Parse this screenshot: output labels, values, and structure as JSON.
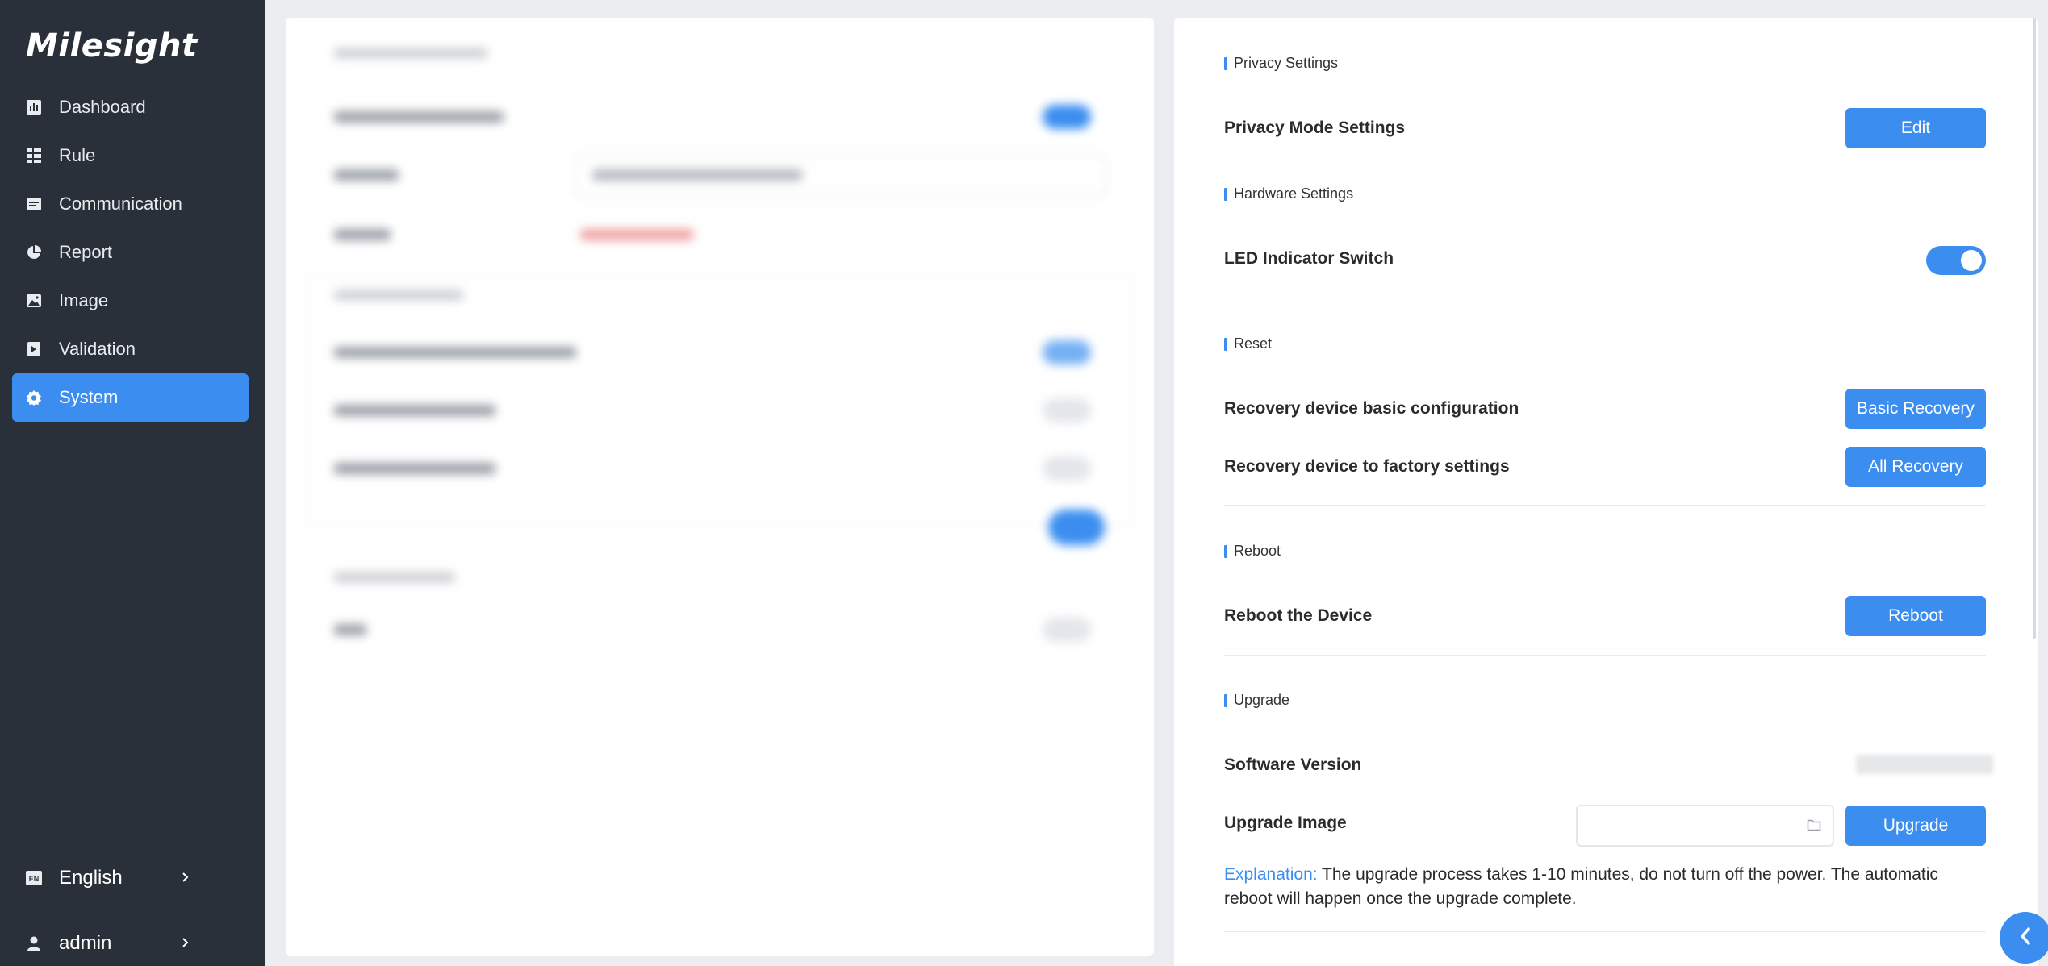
{
  "brand": {
    "logo_text": "Milesight"
  },
  "sidebar": {
    "items": [
      {
        "label": "Dashboard",
        "icon": "dashboard-icon"
      },
      {
        "label": "Rule",
        "icon": "rule-icon"
      },
      {
        "label": "Communication",
        "icon": "communication-icon"
      },
      {
        "label": "Report",
        "icon": "report-icon"
      },
      {
        "label": "Image",
        "icon": "image-icon"
      },
      {
        "label": "Validation",
        "icon": "validation-icon"
      },
      {
        "label": "System",
        "icon": "gear-icon",
        "active": true
      }
    ],
    "language": {
      "label": "English",
      "badge": "EN"
    },
    "user": {
      "label": "admin"
    }
  },
  "settings": {
    "privacy": {
      "section_title": "Privacy Settings",
      "row_label": "Privacy Mode Settings",
      "button_label": "Edit"
    },
    "hardware": {
      "section_title": "Hardware Settings",
      "row_label": "LED Indicator Switch",
      "led_enabled": true
    },
    "reset": {
      "section_title": "Reset",
      "basic_label": "Recovery device basic configuration",
      "basic_button": "Basic Recovery",
      "factory_label": "Recovery device to factory settings",
      "factory_button": "All Recovery"
    },
    "reboot": {
      "section_title": "Reboot",
      "row_label": "Reboot the Device",
      "button_label": "Reboot"
    },
    "upgrade": {
      "section_title": "Upgrade",
      "version_label": "Software Version",
      "image_label": "Upgrade Image",
      "file_value": "",
      "button_label": "Upgrade",
      "explanation_prefix": "Explanation:",
      "explanation_text": " The upgrade process takes 1-10 minutes, do not turn off the power. The automatic reboot will happen once the upgrade complete."
    }
  },
  "colors": {
    "sidebar_bg": "#293039",
    "accent": "#3b8ef0",
    "page_bg": "#ebedf0"
  }
}
